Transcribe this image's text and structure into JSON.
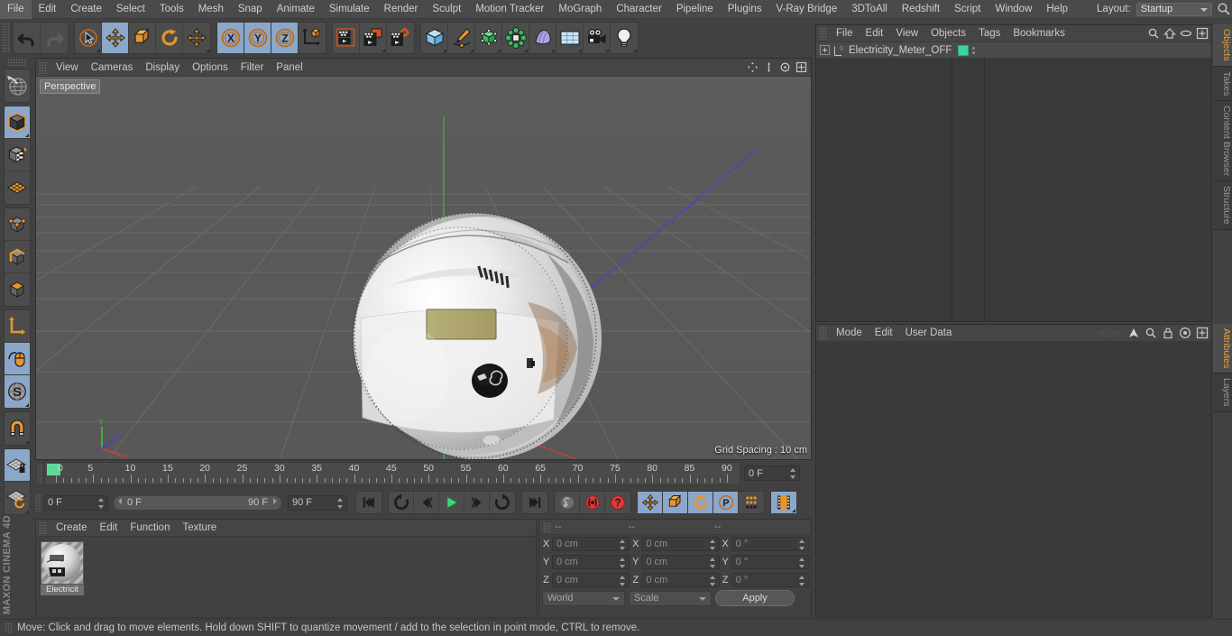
{
  "app": {
    "title": "Cinema 4D",
    "brand": "MAXON CINEMA 4D"
  },
  "menubar": {
    "items": [
      {
        "label": "File"
      },
      {
        "label": "Edit"
      },
      {
        "label": "Create"
      },
      {
        "label": "Select"
      },
      {
        "label": "Tools"
      },
      {
        "label": "Mesh"
      },
      {
        "label": "Snap"
      },
      {
        "label": "Animate"
      },
      {
        "label": "Simulate"
      },
      {
        "label": "Render"
      },
      {
        "label": "Sculpt"
      },
      {
        "label": "Motion Tracker"
      },
      {
        "label": "MoGraph"
      },
      {
        "label": "Character"
      },
      {
        "label": "Pipeline"
      },
      {
        "label": "Plugins"
      },
      {
        "label": "V-Ray Bridge"
      },
      {
        "label": "3DToAll"
      },
      {
        "label": "Redshift"
      },
      {
        "label": "Script"
      },
      {
        "label": "Window"
      },
      {
        "label": "Help"
      }
    ],
    "layout_label": "Layout:",
    "layout_value": "Startup"
  },
  "toolbar": {
    "groups": [
      {
        "name": "history",
        "buttons": [
          {
            "name": "undo-button",
            "icon": "undo-icon",
            "active": false
          },
          {
            "name": "redo-button",
            "icon": "redo-icon",
            "active": false,
            "disabled": true
          }
        ]
      },
      {
        "name": "transform-tools",
        "buttons": [
          {
            "name": "live-selection-tool",
            "icon": "cursor-circle-icon",
            "active": false,
            "corner": true
          },
          {
            "name": "move-tool",
            "icon": "move-arrows-icon",
            "active": true
          },
          {
            "name": "scale-tool",
            "icon": "scale-box-icon",
            "active": false
          },
          {
            "name": "rotate-tool",
            "icon": "rotate-arc-icon",
            "active": false
          },
          {
            "name": "dynamic-place-tool",
            "icon": "move-arrows-icon",
            "active": false,
            "corner": true
          }
        ]
      },
      {
        "name": "axis-locks",
        "buttons": [
          {
            "name": "x-axis-lock",
            "icon": "x-axis-icon",
            "active": true
          },
          {
            "name": "y-axis-lock",
            "icon": "y-axis-icon",
            "active": true
          },
          {
            "name": "z-axis-lock",
            "icon": "z-axis-icon",
            "active": true
          },
          {
            "name": "world-object-coords",
            "icon": "world-axis-cube-icon",
            "active": false
          }
        ]
      },
      {
        "name": "render-tools",
        "buttons": [
          {
            "name": "render-view-button",
            "icon": "render-view-icon",
            "active": false
          },
          {
            "name": "render-to-picture-viewer-button",
            "icon": "render-picture-icon",
            "active": false,
            "corner": true
          },
          {
            "name": "render-settings-button",
            "icon": "render-settings-icon",
            "active": false
          }
        ]
      },
      {
        "name": "create-objects",
        "buttons": [
          {
            "name": "add-cube-button",
            "icon": "cube-icon",
            "active": false,
            "corner": true
          },
          {
            "name": "add-spline-button",
            "icon": "pen-spline-icon",
            "active": false,
            "corner": true
          },
          {
            "name": "add-generator-button",
            "icon": "generator-icon",
            "active": false,
            "corner": true
          },
          {
            "name": "add-deformer-button",
            "icon": "deformer-icon",
            "active": false,
            "corner": true
          },
          {
            "name": "add-scene-object-button",
            "icon": "scene-object-icon",
            "active": false,
            "corner": true
          },
          {
            "name": "add-floor-button",
            "icon": "floor-grid-icon",
            "active": false,
            "corner": true
          },
          {
            "name": "add-camera-button",
            "icon": "camera-icon",
            "active": false,
            "corner": true
          },
          {
            "name": "add-light-button",
            "icon": "light-bulb-icon",
            "active": false,
            "corner": true
          }
        ]
      }
    ]
  },
  "left_toolbar": {
    "groups": [
      {
        "name": "grp-texture",
        "buttons": [
          {
            "name": "texture-axis-tool",
            "icon": "texture-globe-icon",
            "active": false
          }
        ]
      },
      {
        "name": "grp-modes",
        "buttons": [
          {
            "name": "model-mode-button",
            "icon": "model-cube-icon",
            "active": true,
            "corner": true
          },
          {
            "name": "texture-mode-button",
            "icon": "texture-cube-icon",
            "active": false
          },
          {
            "name": "workplane-mode-button",
            "icon": "workplane-grid-icon",
            "active": false
          }
        ]
      },
      {
        "name": "grp-components",
        "buttons": [
          {
            "name": "points-mode-button",
            "icon": "points-cube-icon",
            "active": false
          },
          {
            "name": "edges-mode-button",
            "icon": "edges-cube-icon",
            "active": false
          },
          {
            "name": "polygons-mode-button",
            "icon": "polygons-cube-icon",
            "active": false
          }
        ]
      },
      {
        "name": "grp-axis",
        "buttons": [
          {
            "name": "enable-axis-button",
            "icon": "axis-l-icon",
            "active": false
          },
          {
            "name": "viewport-solo-button",
            "icon": "mouse-icon",
            "active": true
          },
          {
            "name": "soft-selection-button",
            "icon": "s-sphere-icon",
            "active": true,
            "corner": true
          }
        ]
      },
      {
        "name": "grp-snap",
        "buttons": [
          {
            "name": "enable-snap-button",
            "icon": "magnet-icon",
            "active": false,
            "corner": true
          }
        ]
      },
      {
        "name": "grp-workplane",
        "buttons": [
          {
            "name": "lock-workplane-button",
            "icon": "workplane-lock-icon",
            "active": true
          },
          {
            "name": "planar-workplane-button",
            "icon": "workplane-rotate-icon",
            "active": false,
            "corner": true
          }
        ]
      }
    ]
  },
  "viewport": {
    "menus": [
      "View",
      "Cameras",
      "Display",
      "Options",
      "Filter",
      "Panel"
    ],
    "label": "Perspective",
    "grid_spacing": "Grid Spacing : 10 cm",
    "axis_gizmo": {
      "x": "X",
      "y": "Y",
      "z": "Z"
    },
    "colors": {
      "background": "#5a5a5a",
      "grid_line": "#6b6b6b",
      "axis_x": "#c04444",
      "axis_y": "#3fae3f",
      "axis_z": "#4444c8"
    }
  },
  "timeline": {
    "ticks": [
      {
        "label": "0",
        "frame": 0
      },
      {
        "label": "5",
        "frame": 5
      },
      {
        "label": "10",
        "frame": 10
      },
      {
        "label": "15",
        "frame": 15
      },
      {
        "label": "20",
        "frame": 20
      },
      {
        "label": "25",
        "frame": 25
      },
      {
        "label": "30",
        "frame": 30
      },
      {
        "label": "35",
        "frame": 35
      },
      {
        "label": "40",
        "frame": 40
      },
      {
        "label": "45",
        "frame": 45
      },
      {
        "label": "50",
        "frame": 50
      },
      {
        "label": "55",
        "frame": 55
      },
      {
        "label": "60",
        "frame": 60
      },
      {
        "label": "65",
        "frame": 65
      },
      {
        "label": "70",
        "frame": 70
      },
      {
        "label": "75",
        "frame": 75
      },
      {
        "label": "80",
        "frame": 80
      },
      {
        "label": "85",
        "frame": 85
      },
      {
        "label": "90",
        "frame": 90
      }
    ],
    "min_frame": 0,
    "max_frame": 90,
    "current_frame_display": "0 F",
    "playhead_color": "#5fd99a"
  },
  "animbar": {
    "current_frame": "0 F",
    "range_start": "0 F",
    "range_end": "90 F",
    "preview_end": "90 F",
    "buttons": [
      {
        "name": "go-to-start-button",
        "icon": "skip-start-icon",
        "active": false
      },
      {
        "name": "play-backwards-button",
        "icon": "rewind-loop-icon",
        "active": false
      },
      {
        "name": "previous-frame-button",
        "icon": "step-back-icon",
        "active": false
      },
      {
        "name": "play-button",
        "icon": "play-icon",
        "active": false
      },
      {
        "name": "next-frame-button",
        "icon": "step-forward-icon",
        "active": false
      },
      {
        "name": "play-forwards-button",
        "icon": "forward-loop-icon",
        "active": false
      },
      {
        "name": "go-to-end-button",
        "icon": "skip-end-icon",
        "active": false
      },
      {
        "name": "record-active-objects-button",
        "icon": "key-icon",
        "active": false
      },
      {
        "name": "autokeying-button",
        "icon": "record-circle-icon",
        "active": false
      },
      {
        "name": "keyframe-selection-button",
        "icon": "question-circle-icon",
        "active": false
      },
      {
        "name": "record-position-button",
        "icon": "move-arrows-icon",
        "active": true
      },
      {
        "name": "record-scale-button",
        "icon": "scale-box-icon",
        "active": true
      },
      {
        "name": "record-rotation-button",
        "icon": "rotate-arc-icon",
        "active": true
      },
      {
        "name": "record-pla-button",
        "icon": "p-circle-icon",
        "active": true
      },
      {
        "name": "record-parameter-button",
        "icon": "dots-grid-icon",
        "active": false
      },
      {
        "name": "timeline-toggle-button",
        "icon": "film-strip-icon",
        "active": true,
        "corner": true
      }
    ]
  },
  "material_manager": {
    "menus": [
      "Create",
      "Edit",
      "Function",
      "Texture"
    ],
    "materials": [
      {
        "name": "Electricit",
        "selected": true
      }
    ]
  },
  "coordinates_manager": {
    "col_headers": [
      "--",
      "--",
      "--"
    ],
    "position": {
      "label_x": "X",
      "label_y": "Y",
      "label_z": "Z",
      "x": "0 cm",
      "y": "0 cm",
      "z": "0 cm"
    },
    "size": {
      "label_x": "X",
      "label_y": "Y",
      "label_z": "Z",
      "x": "0 cm",
      "y": "0 cm",
      "z": "0 cm"
    },
    "rotation": {
      "label_x": "X",
      "label_y": "Y",
      "label_z": "Z",
      "x": "0 °",
      "y": "0 °",
      "z": "0 °"
    },
    "coord_system": "World",
    "size_mode": "Scale",
    "apply_label": "Apply"
  },
  "object_manager": {
    "menus": [
      "File",
      "Edit",
      "View",
      "Objects",
      "Tags",
      "Bookmarks"
    ],
    "header_icons": [
      "search-icon",
      "home-icon",
      "ellipse-icon",
      "plus-box-icon"
    ],
    "objects": [
      {
        "name": "Electricity_Meter_OFF",
        "icon": "null-object-icon",
        "tag_color": "#3ad39a",
        "expandable": true
      }
    ]
  },
  "attribute_manager": {
    "menus": [
      "Mode",
      "Edit",
      "User Data"
    ],
    "header_icons": [
      "plane-icon",
      "arrow-up-icon",
      "search-icon",
      "lock-icon",
      "target-icon",
      "plus-box-icon"
    ]
  },
  "right_tabs_top": [
    {
      "label": "Objects",
      "active": true
    },
    {
      "label": "Takes",
      "active": false
    },
    {
      "label": "Content Browser",
      "active": false
    },
    {
      "label": "Structure",
      "active": false
    }
  ],
  "right_tabs_bottom": [
    {
      "label": "Attributes",
      "active": true
    },
    {
      "label": "Layers",
      "active": false
    }
  ],
  "statusbar": {
    "message": "Move: Click and drag to move elements. Hold down SHIFT to quantize movement / add to the selection in point mode, CTRL to remove."
  }
}
